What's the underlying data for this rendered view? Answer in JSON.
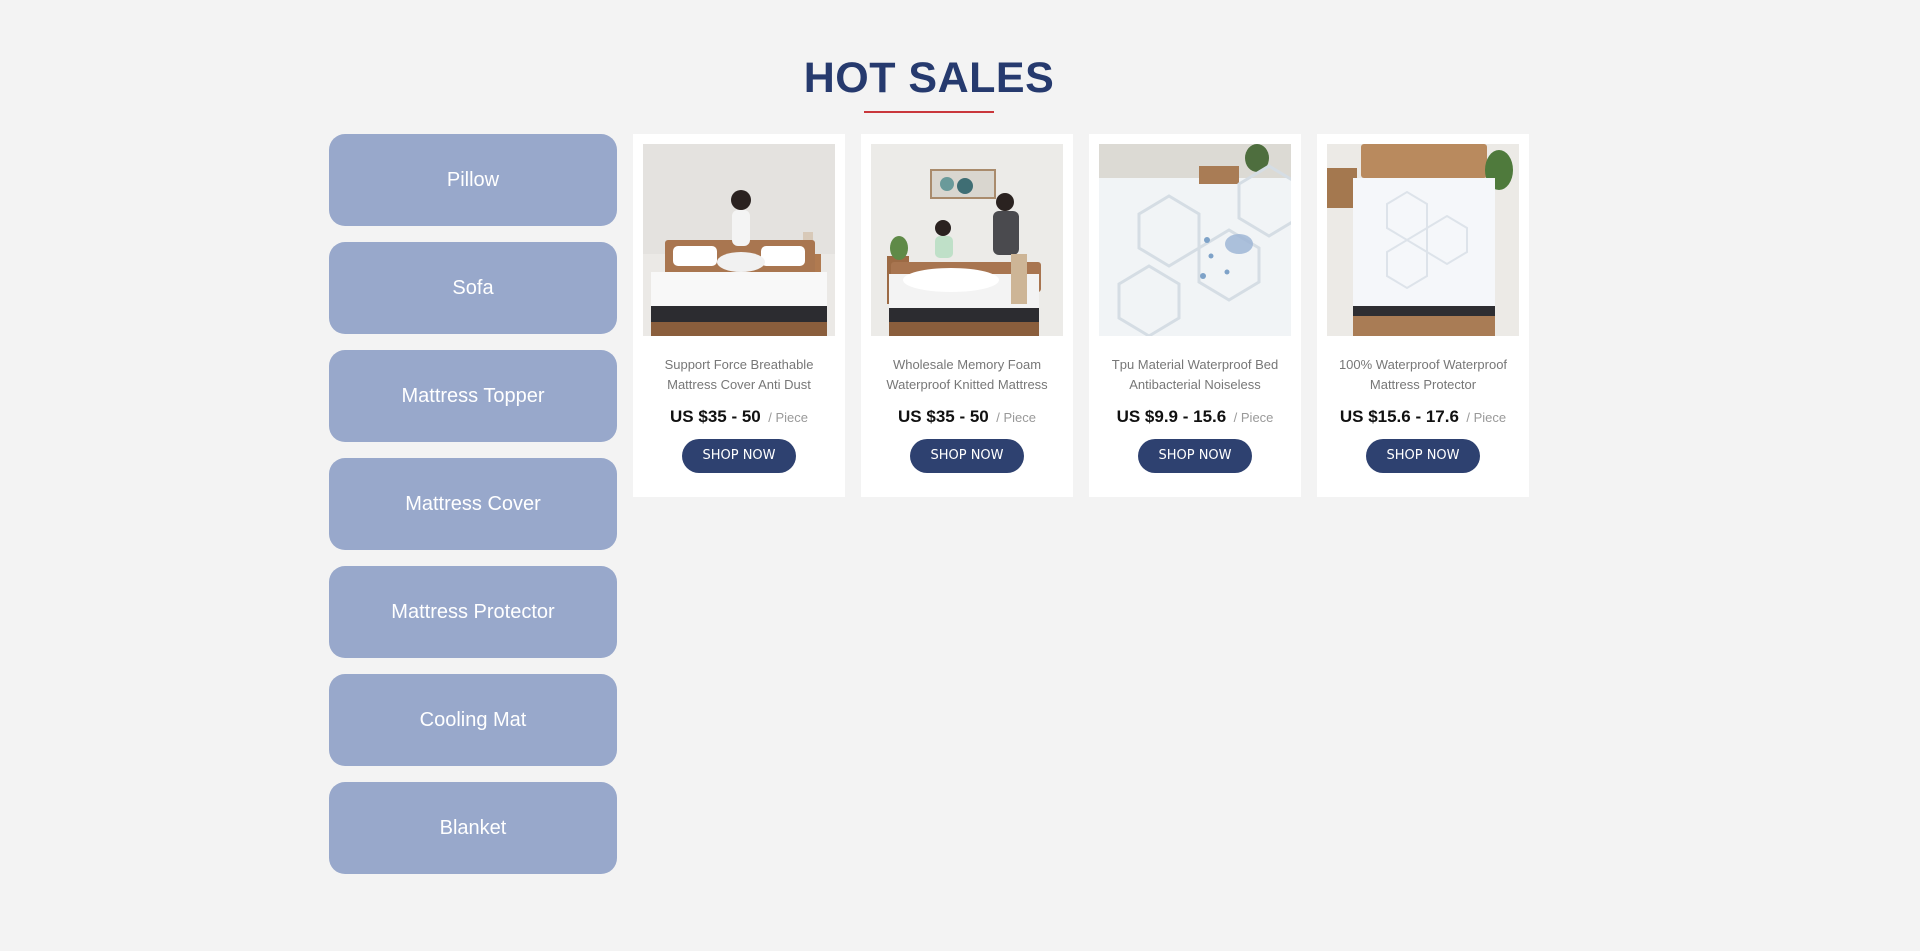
{
  "section": {
    "title": "HOT SALES"
  },
  "categories": [
    {
      "label": "Pillow"
    },
    {
      "label": "Sofa"
    },
    {
      "label": "Mattress Topper"
    },
    {
      "label": "Mattress Cover"
    },
    {
      "label": "Mattress Protector"
    },
    {
      "label": "Cooling Mat"
    },
    {
      "label": "Blanket"
    }
  ],
  "products": [
    {
      "name": "Support Force Breathable Mattress Cover Anti Dust",
      "price": "US $35 - 50",
      "unit": "/ Piece",
      "button": "SHOP NOW",
      "image": "product-photo-woman-sitting-on-mattress"
    },
    {
      "name": "Wholesale Memory Foam Waterproof Knitted Mattress",
      "price": "US $35 - 50",
      "unit": "/ Piece",
      "button": "SHOP NOW",
      "image": "product-photo-couple-making-bed"
    },
    {
      "name": "Tpu Material Waterproof Bed Antibacterial Noiseless",
      "price": "US $9.9 - 15.6",
      "unit": "/ Piece",
      "button": "SHOP NOW",
      "image": "product-photo-spilled-water-on-protector"
    },
    {
      "name": "100% Waterproof Waterproof Mattress Protector",
      "price": "US $15.6 - 17.6",
      "unit": "/ Piece",
      "button": "SHOP NOW",
      "image": "product-photo-mattress-protector-on-bed"
    }
  ],
  "colors": {
    "title": "#263a6e",
    "underline": "#c9363b",
    "category_bg": "#98a8cb",
    "button_bg": "#2e4170",
    "page_bg": "#f3f3f3"
  }
}
